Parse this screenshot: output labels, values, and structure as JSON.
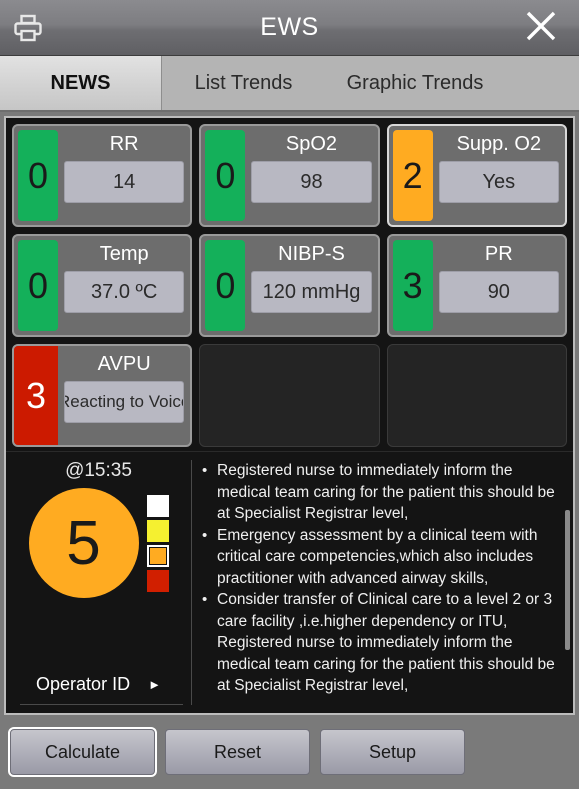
{
  "titlebar": {
    "title": "EWS",
    "print_icon": "printer-icon",
    "close_icon": "close-icon"
  },
  "tabs": [
    {
      "label": "NEWS",
      "active": true
    },
    {
      "label": "List Trends",
      "active": false
    },
    {
      "label": "Graphic Trends",
      "active": false
    }
  ],
  "parameters": [
    {
      "label": "RR",
      "score": "0",
      "value": "14",
      "score_color": "#14b05a",
      "score_text_color": "#1a1a1a",
      "selected": false
    },
    {
      "label": "SpO2",
      "score": "0",
      "value": "98",
      "score_color": "#14b05a",
      "score_text_color": "#1a1a1a",
      "selected": false
    },
    {
      "label": "Supp. O2",
      "score": "2",
      "value": "Yes",
      "score_color": "#ffab21",
      "score_text_color": "#1a1a1a",
      "selected": true
    },
    {
      "label": "Temp",
      "score": "0",
      "value": "37.0 ºC",
      "score_color": "#14b05a",
      "score_text_color": "#1a1a1a",
      "selected": false
    },
    {
      "label": "NIBP-S",
      "score": "0",
      "value": "120 mmHg",
      "score_color": "#14b05a",
      "score_text_color": "#1a1a1a",
      "selected": false
    },
    {
      "label": "PR",
      "score": "3",
      "value": "90",
      "score_color": "#14b05a",
      "score_text_color": "#1a1a1a",
      "selected": false
    },
    {
      "label": "AVPU",
      "score": "3",
      "value": "Reacting to Voice",
      "score_color": "#cc1a00",
      "score_text_color": "#ffffff",
      "selected": false
    }
  ],
  "summary": {
    "timestamp": "@15:35",
    "total_score": "5",
    "total_score_color": "#ffab21",
    "legend": [
      {
        "name": "white-level",
        "color": "#ffffff",
        "active": false
      },
      {
        "name": "yellow-level",
        "color": "#f5f030",
        "active": false
      },
      {
        "name": "orange-level",
        "color": "#ffab21",
        "active": true
      },
      {
        "name": "red-level",
        "color": "#d11f00",
        "active": false
      }
    ],
    "operator_label": "Operator ID",
    "operator_arrow": "►",
    "recommendations": [
      "Registered nurse to immediately inform the medical team caring for the patient this should be at Specialist Registrar level,",
      "Emergency assessment by a clinical teem with critical care competencies,which also includes practitioner with advanced airway skills,",
      "Consider transfer of Clinical care to a level 2 or 3 care facility ,i.e.higher dependency or ITU, Registered nurse to immediately inform the medical team caring for the patient this should be at Specialist Registrar level,"
    ]
  },
  "buttons": [
    {
      "label": "Calculate",
      "focused": true
    },
    {
      "label": "Reset",
      "focused": false
    },
    {
      "label": "Setup",
      "focused": false
    }
  ]
}
